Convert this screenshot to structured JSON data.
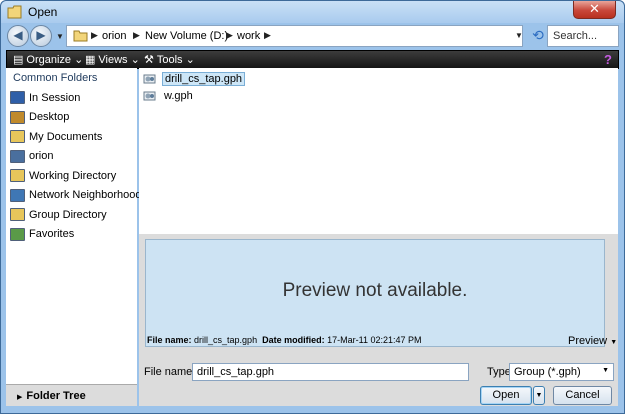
{
  "window": {
    "title": "Open",
    "close_label": "✕"
  },
  "address_bar": {
    "crumbs": [
      "orion",
      "New Volume (D:)",
      "work"
    ],
    "search_placeholder": "Search..."
  },
  "toolbar": {
    "organize_label": "Organize",
    "views_label": "Views",
    "tools_label": "Tools"
  },
  "sidebar": {
    "header": "Common Folders",
    "items": [
      {
        "label": "In Session",
        "icon": "monitor-icon",
        "color": "#2f5fa8"
      },
      {
        "label": "Desktop",
        "icon": "desktop-icon",
        "color": "#c08a2c"
      },
      {
        "label": "My Documents",
        "icon": "documents-folder-icon",
        "color": "#e7c65b"
      },
      {
        "label": "orion",
        "icon": "computer-icon",
        "color": "#4a6f9e"
      },
      {
        "label": "Working Directory",
        "icon": "folder-icon",
        "color": "#e7c65b"
      },
      {
        "label": "Network Neighborhood",
        "icon": "network-icon",
        "color": "#3f77b5"
      },
      {
        "label": "Group Directory",
        "icon": "group-folder-icon",
        "color": "#e7c65b"
      },
      {
        "label": "Favorites",
        "icon": "favorites-icon",
        "color": "#5a9a48"
      }
    ],
    "folder_tree_label": "Folder Tree"
  },
  "files": [
    {
      "name": "drill_cs_tap.gph",
      "selected": true
    },
    {
      "name": "w.gph",
      "selected": false
    }
  ],
  "preview": {
    "message": "Preview not available.",
    "file_name_label": "File name:",
    "file_name_value": "drill_cs_tap.gph",
    "date_modified_label": "Date modified:",
    "date_modified_value": "17-Mar-11 02:21:47 PM",
    "toggle_label": "Preview"
  },
  "form": {
    "file_name_label": "File name:",
    "file_name_value": "drill_cs_tap.gph",
    "type_label": "Type",
    "type_value": "Group (*.gph)",
    "open_label": "Open",
    "cancel_label": "Cancel"
  },
  "colors": {
    "frame": "#9cc3ea",
    "toolbar": "#1f1f1f",
    "selection": "#cde6f7",
    "preview_bg": "#cde3f3"
  }
}
